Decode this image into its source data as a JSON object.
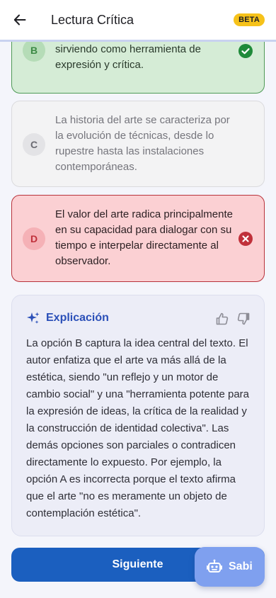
{
  "header": {
    "title": "Lectura Crítica",
    "badge": "BETA"
  },
  "options": [
    {
      "letter": "B",
      "text": "reflejo y un motor de cambio social, sirviendo como herramienta de expresión y crítica.",
      "state": "correct"
    },
    {
      "letter": "C",
      "text": "La historia del arte se caracteriza por la evolución de técnicas, desde lo rupestre hasta las instalaciones contemporáneas.",
      "state": "neutral"
    },
    {
      "letter": "D",
      "text": "El valor del arte radica principalmente en su capacidad para dialogar con su tiempo e interpelar directamente al observador.",
      "state": "incorrect"
    }
  ],
  "explanation": {
    "title": "Explicación",
    "body": "La opción B captura la idea central del texto. El autor enfatiza que el arte va más allá de la estética, siendo \"un reflejo y un motor de cambio social\" y una \"herramienta potente para la expresión de ideas, la crítica de la realidad y la construcción de identidad colectiva\". Las demás opciones son parciales o contradicen directamente lo expuesto. Por ejemplo, la opción A es incorrecta porque el texto afirma que el arte \"no es meramente un objeto de contemplación estética\"."
  },
  "actions": {
    "next_label": "Siguiente",
    "assistant_label": "Sabi"
  },
  "colors": {
    "primary": "#1b5fbf",
    "correct": "#2e8b3a",
    "incorrect": "#c0303a",
    "badge": "#f6c21a",
    "accent": "#2a4fb8"
  }
}
